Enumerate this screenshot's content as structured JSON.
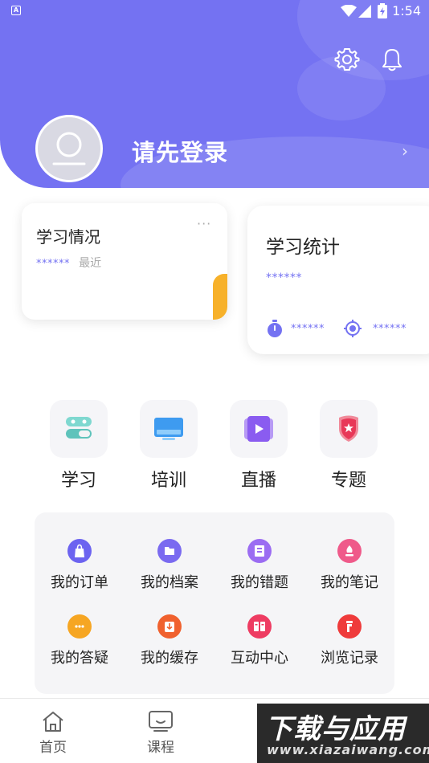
{
  "status_bar": {
    "time": "1:54",
    "app_badge": "A"
  },
  "header": {
    "login_prompt": "请先登录"
  },
  "card_study": {
    "title": "学习情况",
    "masked_value": "******",
    "recent_label": "最近"
  },
  "card_stats": {
    "title": "学习统计",
    "masked_total": "******",
    "masked_time": "******",
    "masked_points": "******"
  },
  "quick_entries": [
    {
      "label": "学习",
      "icon": "study-icon"
    },
    {
      "label": "培训",
      "icon": "training-icon"
    },
    {
      "label": "直播",
      "icon": "live-icon"
    },
    {
      "label": "专题",
      "icon": "topic-icon"
    }
  ],
  "my_items": [
    {
      "label": "我的订单",
      "icon": "order-bag-icon",
      "color": "#6c63f0"
    },
    {
      "label": "我的档案",
      "icon": "archive-folder-icon",
      "color": "#7a6af0"
    },
    {
      "label": "我的错题",
      "icon": "wrong-questions-icon",
      "color": "#9b6cf2"
    },
    {
      "label": "我的笔记",
      "icon": "notes-icon",
      "color": "#ef5a8a"
    },
    {
      "label": "我的答疑",
      "icon": "qa-chat-icon",
      "color": "#f6a623"
    },
    {
      "label": "我的缓存",
      "icon": "cache-download-icon",
      "color": "#f0612e"
    },
    {
      "label": "互动中心",
      "icon": "interaction-icon",
      "color": "#ee3c62"
    },
    {
      "label": "浏览记录",
      "icon": "history-footprint-icon",
      "color": "#ef3b3b"
    }
  ],
  "nav": {
    "home": "首页",
    "courses": "课程"
  },
  "watermark": {
    "line1": "下载与应用",
    "line2": "www.xiazaiwang.com"
  },
  "colors": {
    "primary": "#7472f2",
    "accent_orange": "#f7b12a"
  }
}
